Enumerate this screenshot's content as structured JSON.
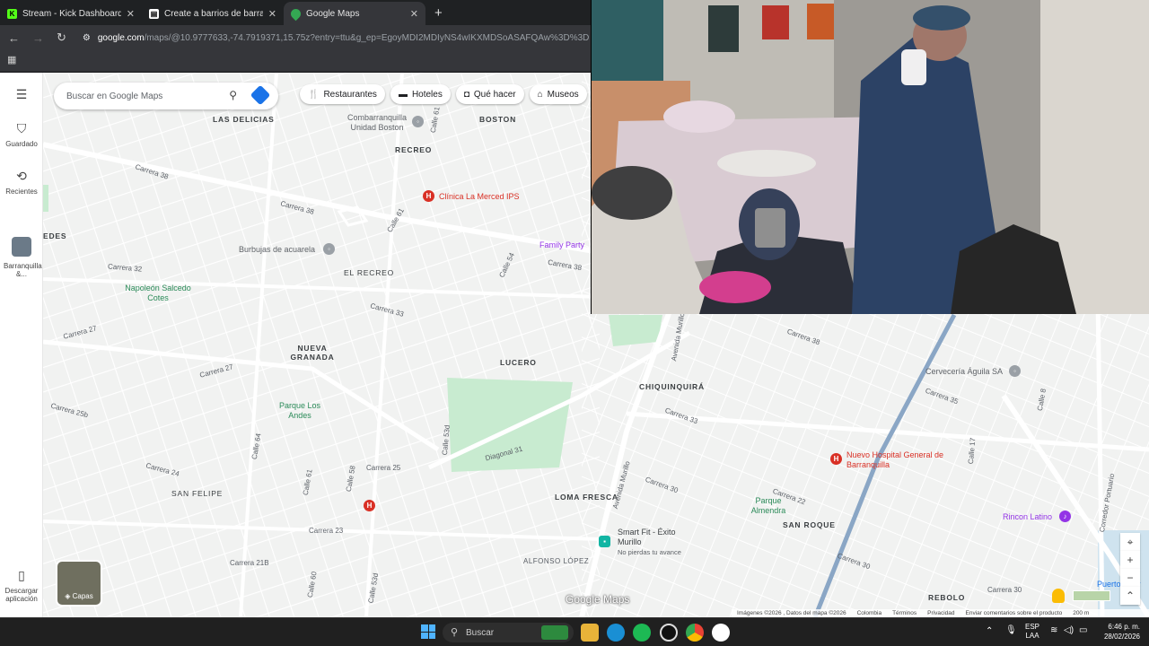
{
  "browser": {
    "tabs": [
      {
        "title": "Stream - Kick Dashboard",
        "favicon": "kick-icon",
        "active": false
      },
      {
        "title": "Create a barrios de barranquilla",
        "favicon": "doc-icon",
        "active": false
      },
      {
        "title": "Google Maps",
        "favicon": "maps-icon",
        "active": true
      }
    ],
    "new_tab": "+",
    "url_host": "google.com",
    "url_path": "/maps/@10.9777633,-74.7919371,15.75z?entry=ttu&g_ep=EgoyMDI2MDIyNS4wIKXMDSoASAFQAw%3D%3D"
  },
  "maps": {
    "search_placeholder": "Buscar en Google Maps",
    "chips": [
      {
        "label": "Restaurantes",
        "icon": "fork-knife-icon"
      },
      {
        "label": "Hoteles",
        "icon": "bed-icon"
      },
      {
        "label": "Qué hacer",
        "icon": "camera-icon"
      },
      {
        "label": "Museos",
        "icon": "museum-icon"
      }
    ],
    "rail": {
      "saved": "Guardado",
      "recent": "Recientes",
      "recent_place": "Barranquilla &...",
      "download": "Descargar aplicación"
    },
    "neighborhoods": [
      "LAS DELICIAS",
      "BOSTON",
      "RECREO",
      "EL RECREO",
      "NUEVA GRANADA",
      "LUCERO",
      "CHIQUINQUIRÁ",
      "LOMA FRESCA",
      "SAN ROQUE",
      "SAN FELIPE",
      "REBOLO",
      "EDES"
    ],
    "pois": {
      "clinica": "Clínica La Merced IPS",
      "combarranquilla": "Combarranquilla Unidad Boston",
      "family_party": "Family Party",
      "burbujas": "Burbujas de acuarela",
      "napoleon": "Napoleón Salcedo Cotes",
      "parque_andes": "Parque Los Andes",
      "cerveceria": "Cervecería Águila SA",
      "hospital": "Nuevo Hospital General de Barranquilla",
      "parque_almendra": "Parque Almendra",
      "rincon": "Rincon Latino",
      "smartfit": "Smart Fit - Éxito Murillo",
      "smartfit_sub": "No pierdas tu avance",
      "alfonso": "ALFONSO LÓPEZ",
      "puerto": "Puerto - Bar"
    },
    "streets": [
      "Calle 61",
      "Carrera 38",
      "Carrera 33",
      "Carrera 32",
      "Carrera 27",
      "Carrera 25",
      "Carrera 25b",
      "Carrera 24",
      "Carrera 23",
      "Carrera 21B",
      "Calle 64",
      "Calle 58",
      "Calle 60",
      "Calle 53d",
      "Calle 54",
      "Calle 55",
      "Diagonal 31",
      "Avenida Murillo",
      "Carrera 35",
      "Carrera 30",
      "Calle 17",
      "Corredor Portuario",
      "Calle 8",
      "Carrera 22"
    ],
    "layers_label": "Capas",
    "logo": "Google Maps",
    "footer": [
      "Imágenes ©2026 , Datos del mapa ©2026",
      "Colombia",
      "Términos",
      "Privacidad",
      "Enviar comentarios sobre el producto",
      "200 m"
    ]
  },
  "taskbar": {
    "search_label": "Buscar",
    "lang_top": "ESP",
    "lang_bottom": "LAA",
    "time": "6:46 p. m.",
    "date": "28/02/2026"
  },
  "colors": {
    "map_bg": "#f3f4f3",
    "park": "#c8ebd0",
    "medical": "#d93025",
    "poi_teal": "#2a8a58",
    "shopping": "#1a73e8",
    "route": "#8aa6c5"
  }
}
